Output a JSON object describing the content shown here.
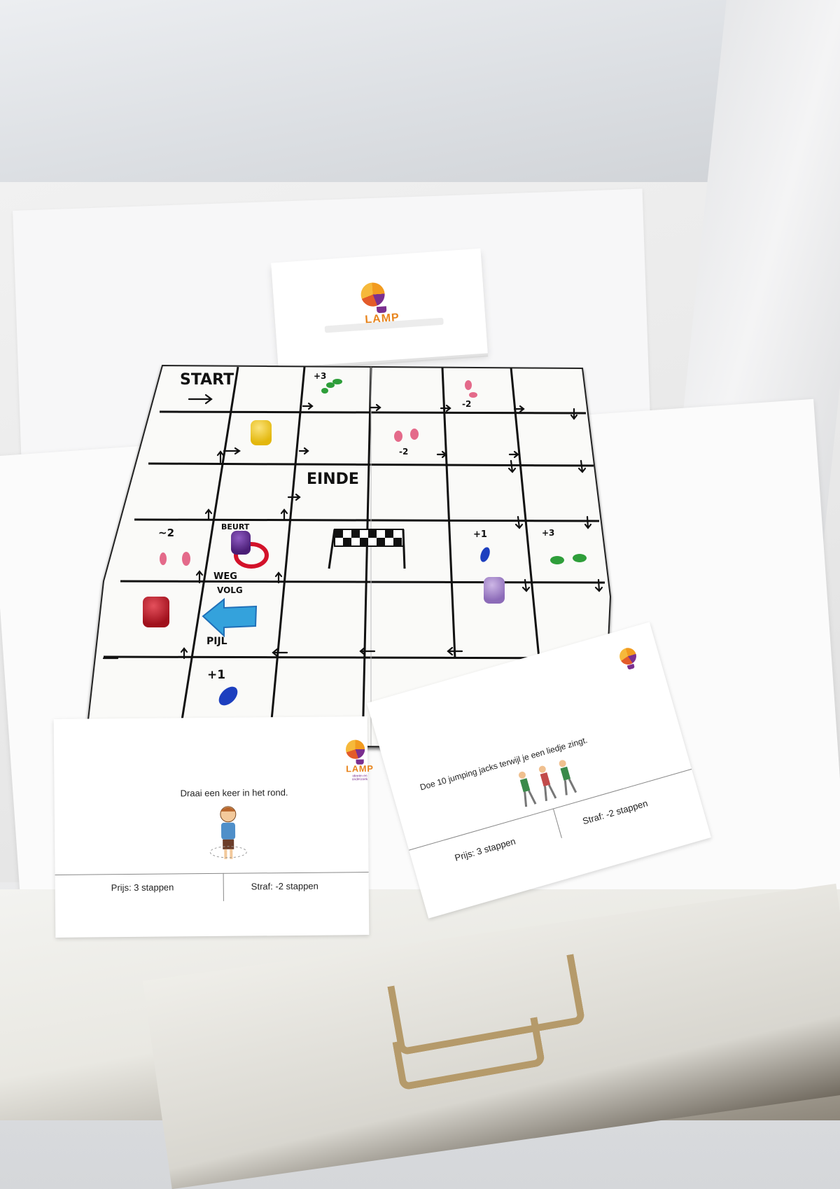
{
  "deck": {
    "logo_text": "LAMP",
    "logo_sub": "ideeën en onderzoek"
  },
  "board": {
    "start_label": "START",
    "finish_label": "EINDE",
    "turn_label": "BEURT",
    "follow_label_1": "WEG",
    "follow_label_2": "VOLG",
    "arrow_label": "PIJL",
    "bonus_plus3_a": "+3",
    "bonus_minus2_a": "-2",
    "bonus_minus2_b": "-2",
    "bonus_minus2_c": "~2",
    "bonus_plus1_a": "+1",
    "bonus_plus3_b": "+3",
    "bonus_plus1_b": "+1"
  },
  "pieces": [
    {
      "name": "yellow-pawn",
      "color": "#f1c40f"
    },
    {
      "name": "purple-pawn",
      "color": "#5b2a86"
    },
    {
      "name": "lilac-pawn",
      "color": "#a083c6"
    },
    {
      "name": "red-pawn",
      "color": "#c1121f"
    }
  ],
  "card_left": {
    "logo_text": "LAMP",
    "logo_sub": "ideeën en onderzoek",
    "instruction": "Draai een keer in het rond.",
    "prize": "Prijs: 3 stappen",
    "penalty": "Straf: -2 stappen"
  },
  "card_right": {
    "instruction": "Doe 10 jumping jacks terwijl je een liedje zingt.",
    "prize": "Prijs: 3 stappen",
    "penalty": "Straf: -2 stappen"
  }
}
